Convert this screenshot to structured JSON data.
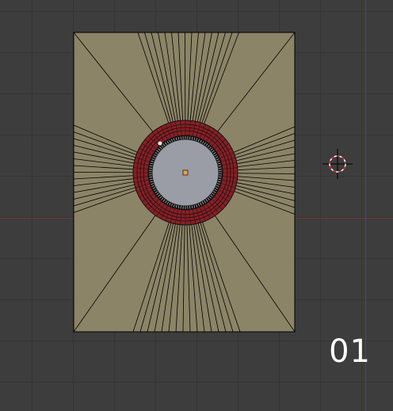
{
  "viewport": {
    "frame_label": "01",
    "colors": {
      "background": "#3d3d3d",
      "grid": "#353535",
      "x_axis": "#7a3434",
      "y_axis": "#3d3dbf",
      "mesh_face": "#8c8467",
      "wire": "#000000",
      "selected_edge": "#8a1e24",
      "inner_disc": "#9a9ca6",
      "origin": "#f0a040"
    },
    "icons": {
      "cursor": "3d-cursor-icon",
      "origin": "object-origin-icon"
    }
  }
}
